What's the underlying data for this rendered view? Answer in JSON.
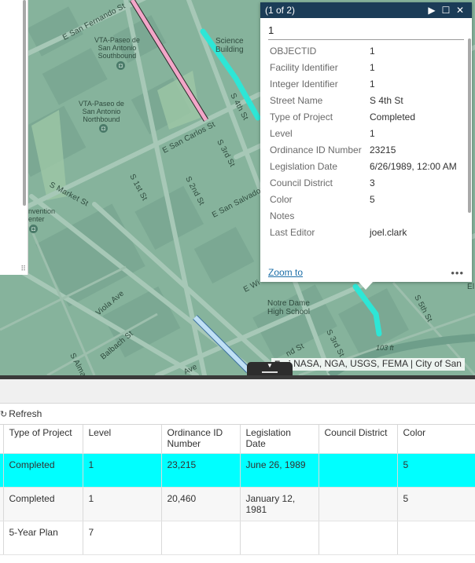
{
  "map": {
    "streets": [
      "E San Fernando St",
      "S 4th St",
      "E San Carlos St",
      "S 3rd St",
      "S Market St",
      "S 1st St",
      "S 2nd St",
      "E San Salvador",
      "Viola Ave",
      "Balbach St",
      "S Alma",
      "E Wi",
      "nd St",
      "S 3rd St",
      "S 5th St",
      "Ave",
      "El"
    ],
    "places": {
      "vta_southbound": "VTA-Paseo de\nSan Antonio\nSouthbound",
      "vta_northbound": "VTA-Paseo de\nSan Antonio\nNorthbound",
      "science_building": "Science\nBuilding",
      "convention_center": "nvention\nenter",
      "notre_dame": "Notre Dame\nHigh School",
      "top_cut": "Science Bldg"
    },
    "elevation": "103 ft",
    "attribution_esri": "Esri",
    "attribution_text": "NASA, NGA, USGS, FEMA | City of San",
    "colors": {
      "pink_line": "#f2a6c8",
      "cyan_line": "#2ee6d6",
      "blue_line": "#bfe0f5"
    }
  },
  "popup": {
    "counter": "(1 of 2)",
    "title": "1",
    "attributes": [
      {
        "key": "OBJECTID",
        "value": "1"
      },
      {
        "key": "Facility Identifier",
        "value": "1"
      },
      {
        "key": "Integer Identifier",
        "value": "1"
      },
      {
        "key": "Street Name",
        "value": "S 4th St"
      },
      {
        "key": "Type of Project",
        "value": "Completed"
      },
      {
        "key": "Level",
        "value": "1"
      },
      {
        "key": "Ordinance ID Number",
        "value": "23215"
      },
      {
        "key": "Legislation Date",
        "value": "6/26/1989, 12:00 AM"
      },
      {
        "key": "Council District",
        "value": "3"
      },
      {
        "key": "Color",
        "value": "5"
      },
      {
        "key": "Notes",
        "value": ""
      },
      {
        "key": "Last Editor",
        "value": "joel.clark"
      }
    ],
    "zoom_to": "Zoom to",
    "more": "•••"
  },
  "table": {
    "refresh_label": "Refresh",
    "columns": [
      "Type of Project",
      "Level",
      "Ordinance ID Number",
      "Legislation Date",
      "Council District",
      "Color"
    ],
    "rows": [
      {
        "cells": [
          "Completed",
          "1",
          "23,215",
          "June 26, 1989",
          "",
          "5"
        ],
        "selected": true
      },
      {
        "cells": [
          "Completed",
          "1",
          "20,460",
          "January 12, 1981",
          "",
          "5"
        ],
        "selected": false
      },
      {
        "cells": [
          "5-Year Plan",
          "7",
          "",
          "",
          "",
          ""
        ],
        "selected": false
      }
    ]
  }
}
